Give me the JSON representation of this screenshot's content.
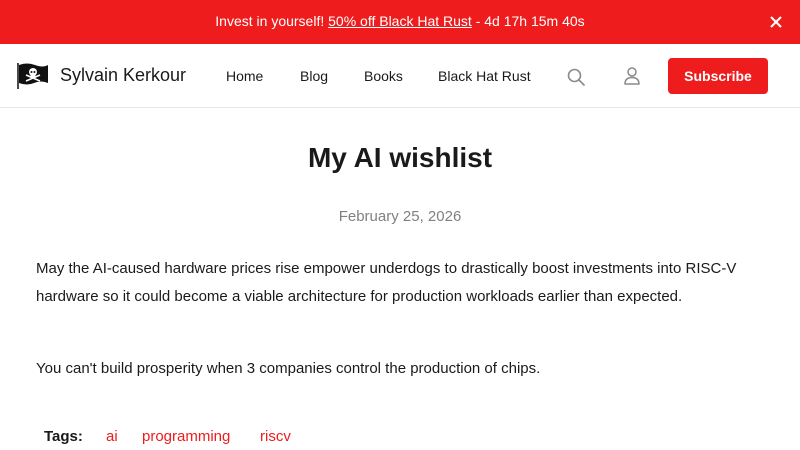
{
  "banner": {
    "lead": "Invest in yourself!",
    "link": "50% off Black Hat Rust",
    "countdown": "- 4d 17h 15m 40s",
    "close_icon": "close-icon"
  },
  "header": {
    "logo_icon": "pirate-flag-icon",
    "site_name": "Sylvain Kerkour",
    "nav": {
      "home": "Home",
      "blog": "Blog",
      "books": "Books",
      "black_hat_rust": "Black Hat Rust"
    },
    "search_icon": "search-icon",
    "account_icon": "user-icon",
    "subscribe": "Subscribe"
  },
  "post": {
    "title": "My AI wishlist",
    "date": "February 25, 2026",
    "paragraphs": [
      "May the AI-caused hardware prices rise empower underdogs to drastically boost investments into RISC-V hardware so it could become a viable architecture for production workloads earlier than expected.",
      "You can't build prosperity when 3 companies control the production of chips."
    ],
    "tags_label": "Tags:",
    "tags": [
      "ai",
      "programming",
      "riscv"
    ]
  },
  "colors": {
    "accent": "#ee1c1c",
    "text": "#1a1a1a",
    "muted": "#808080",
    "border": "#e6e6e6"
  }
}
